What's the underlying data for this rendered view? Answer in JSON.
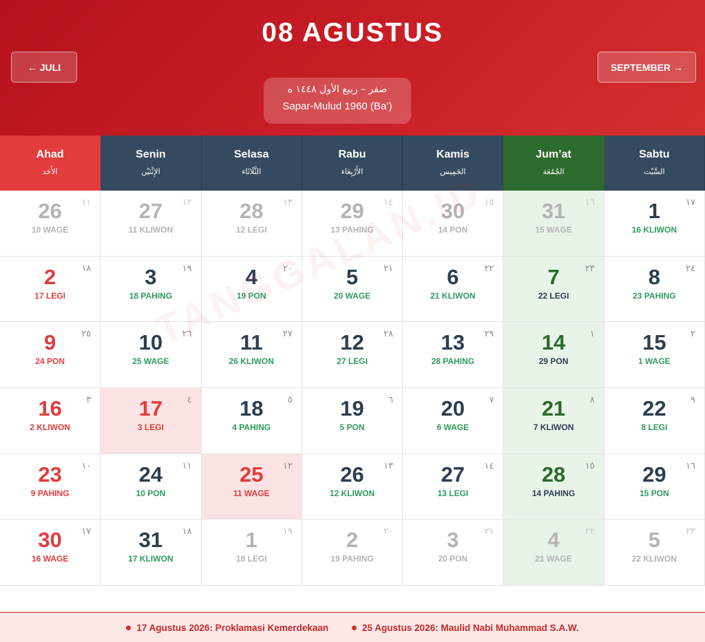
{
  "header": {
    "title": "08 AGUSTUS",
    "prev_label": "← JULI",
    "next_label": "SEPTEMBER →",
    "hijri_arabic": "صفر – ربيع الأول ١٤٤٨ ه",
    "hijri_latin": "Sapar-Mulud 1960 (Ba’)"
  },
  "weekdays": [
    {
      "latin": "Ahad",
      "arabic": "الأَحَد"
    },
    {
      "latin": "Senin",
      "arabic": "الإِثْنَيْن"
    },
    {
      "latin": "Selasa",
      "arabic": "الثَّلَاثَاء"
    },
    {
      "latin": "Rabu",
      "arabic": "الأَرْبِعَاء"
    },
    {
      "latin": "Kamis",
      "arabic": "الخَمِيس"
    },
    {
      "latin": "Jum’at",
      "arabic": "الجُمُعَة"
    },
    {
      "latin": "Sabtu",
      "arabic": "السَّبْت"
    }
  ],
  "weeks": [
    [
      {
        "day": "26",
        "pasaran": "10 WAGE",
        "hijri": "١١",
        "other": true
      },
      {
        "day": "27",
        "pasaran": "11 KLIWON",
        "hijri": "١٢",
        "other": true
      },
      {
        "day": "28",
        "pasaran": "12 LEGI",
        "hijri": "١٣",
        "other": true
      },
      {
        "day": "29",
        "pasaran": "13 PAHING",
        "hijri": "١٤",
        "other": true
      },
      {
        "day": "30",
        "pasaran": "14 PON",
        "hijri": "١٥",
        "other": true
      },
      {
        "day": "31",
        "pasaran": "15 WAGE",
        "hijri": "١٦",
        "other": true
      },
      {
        "day": "1",
        "pasaran": "16 KLIWON",
        "hijri": "١٧"
      }
    ],
    [
      {
        "day": "2",
        "pasaran": "17 LEGI",
        "hijri": "١٨"
      },
      {
        "day": "3",
        "pasaran": "18 PAHING",
        "hijri": "١٩"
      },
      {
        "day": "4",
        "pasaran": "19 PON",
        "hijri": "٢٠"
      },
      {
        "day": "5",
        "pasaran": "20 WAGE",
        "hijri": "٢١"
      },
      {
        "day": "6",
        "pasaran": "21 KLIWON",
        "hijri": "٢٢"
      },
      {
        "day": "7",
        "pasaran": "22 LEGI",
        "hijri": "٢٣"
      },
      {
        "day": "8",
        "pasaran": "23 PAHING",
        "hijri": "٢٤"
      }
    ],
    [
      {
        "day": "9",
        "pasaran": "24 PON",
        "hijri": "٢٥"
      },
      {
        "day": "10",
        "pasaran": "25 WAGE",
        "hijri": "٢٦"
      },
      {
        "day": "11",
        "pasaran": "26 KLIWON",
        "hijri": "٢٧"
      },
      {
        "day": "12",
        "pasaran": "27 LEGI",
        "hijri": "٢٨"
      },
      {
        "day": "13",
        "pasaran": "28 PAHING",
        "hijri": "٢٩"
      },
      {
        "day": "14",
        "pasaran": "29 PON",
        "hijri": "١"
      },
      {
        "day": "15",
        "pasaran": "1 WAGE",
        "hijri": "٢"
      }
    ],
    [
      {
        "day": "16",
        "pasaran": "2 KLIWON",
        "hijri": "٣"
      },
      {
        "day": "17",
        "pasaran": "3 LEGI",
        "hijri": "٤",
        "highlight": true
      },
      {
        "day": "18",
        "pasaran": "4 PAHING",
        "hijri": "٥"
      },
      {
        "day": "19",
        "pasaran": "5 PON",
        "hijri": "٦"
      },
      {
        "day": "20",
        "pasaran": "6 WAGE",
        "hijri": "٧"
      },
      {
        "day": "21",
        "pasaran": "7 KLIWON",
        "hijri": "٨"
      },
      {
        "day": "22",
        "pasaran": "8 LEGI",
        "hijri": "٩"
      }
    ],
    [
      {
        "day": "23",
        "pasaran": "9 PAHING",
        "hijri": "١٠"
      },
      {
        "day": "24",
        "pasaran": "10 PON",
        "hijri": "١١"
      },
      {
        "day": "25",
        "pasaran": "11 WAGE",
        "hijri": "١٢",
        "highlight": true
      },
      {
        "day": "26",
        "pasaran": "12 KLIWON",
        "hijri": "١٣"
      },
      {
        "day": "27",
        "pasaran": "13 LEGI",
        "hijri": "١٤"
      },
      {
        "day": "28",
        "pasaran": "14 PAHING",
        "hijri": "١٥"
      },
      {
        "day": "29",
        "pasaran": "15 PON",
        "hijri": "١٦"
      }
    ],
    [
      {
        "day": "30",
        "pasaran": "16 WAGE",
        "hijri": "١٧"
      },
      {
        "day": "31",
        "pasaran": "17 KLIWON",
        "hijri": "١٨"
      },
      {
        "day": "1",
        "pasaran": "18 LEGI",
        "hijri": "١٩",
        "other": true
      },
      {
        "day": "2",
        "pasaran": "19 PAHING",
        "hijri": "٢٠",
        "other": true
      },
      {
        "day": "3",
        "pasaran": "20 PON",
        "hijri": "٢١",
        "other": true
      },
      {
        "day": "4",
        "pasaran": "21 WAGE",
        "hijri": "٢٢",
        "other": true
      },
      {
        "day": "5",
        "pasaran": "22 KLIWON",
        "hijri": "٢٣",
        "other": true
      }
    ]
  ],
  "watermark": "TANGGALAN.ID",
  "holidays": [
    "17 Agustus 2026: Proklamasi Kemerdekaan",
    "25 Agustus 2026: Maulid Nabi Muhammad S.A.W."
  ],
  "colors": {
    "header_red": "#c91f26",
    "weekday_bg": "#344a5e",
    "sunday_red": "#e23c3c",
    "friday_green": "#2d6a2d",
    "pasaran_green": "#2e9b5e",
    "holiday_bg": "#fbe3e3"
  }
}
